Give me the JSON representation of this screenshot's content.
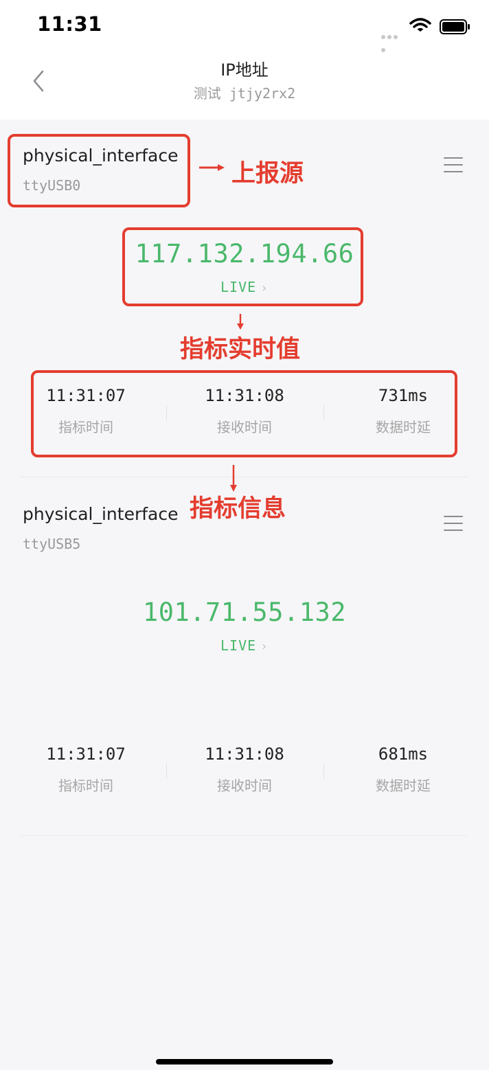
{
  "status_bar": {
    "time": "11:31"
  },
  "header": {
    "title": "IP地址",
    "subtitle": "测试 jtjy2rx2"
  },
  "cards": [
    {
      "name": "physical_interface",
      "source": "ttyUSB0",
      "ip": "117.132.194.66",
      "live_label": "LIVE",
      "stats": [
        {
          "value": "11:31:07",
          "label": "指标时间"
        },
        {
          "value": "11:31:08",
          "label": "接收时间"
        },
        {
          "value": "731ms",
          "label": "数据时延"
        }
      ]
    },
    {
      "name": "physical_interface",
      "source": "ttyUSB5",
      "ip": "101.71.55.132",
      "live_label": "LIVE",
      "stats": [
        {
          "value": "11:31:07",
          "label": "指标时间"
        },
        {
          "value": "11:31:08",
          "label": "接收时间"
        },
        {
          "value": "681ms",
          "label": "数据时延"
        }
      ]
    }
  ],
  "annotations": {
    "source": "上报源",
    "realtime_value": "指标实时值",
    "metric_info": "指标信息"
  },
  "colors": {
    "accent_green": "#4ab86a",
    "annotation_red": "#e43d2f",
    "background": "#f6f6f9"
  },
  "icons": [
    "signal-icon",
    "wifi-icon",
    "battery-icon",
    "back-chevron-icon",
    "menu-icon",
    "chevron-right-icon",
    "arrow-right-icon",
    "arrow-down-icon"
  ]
}
